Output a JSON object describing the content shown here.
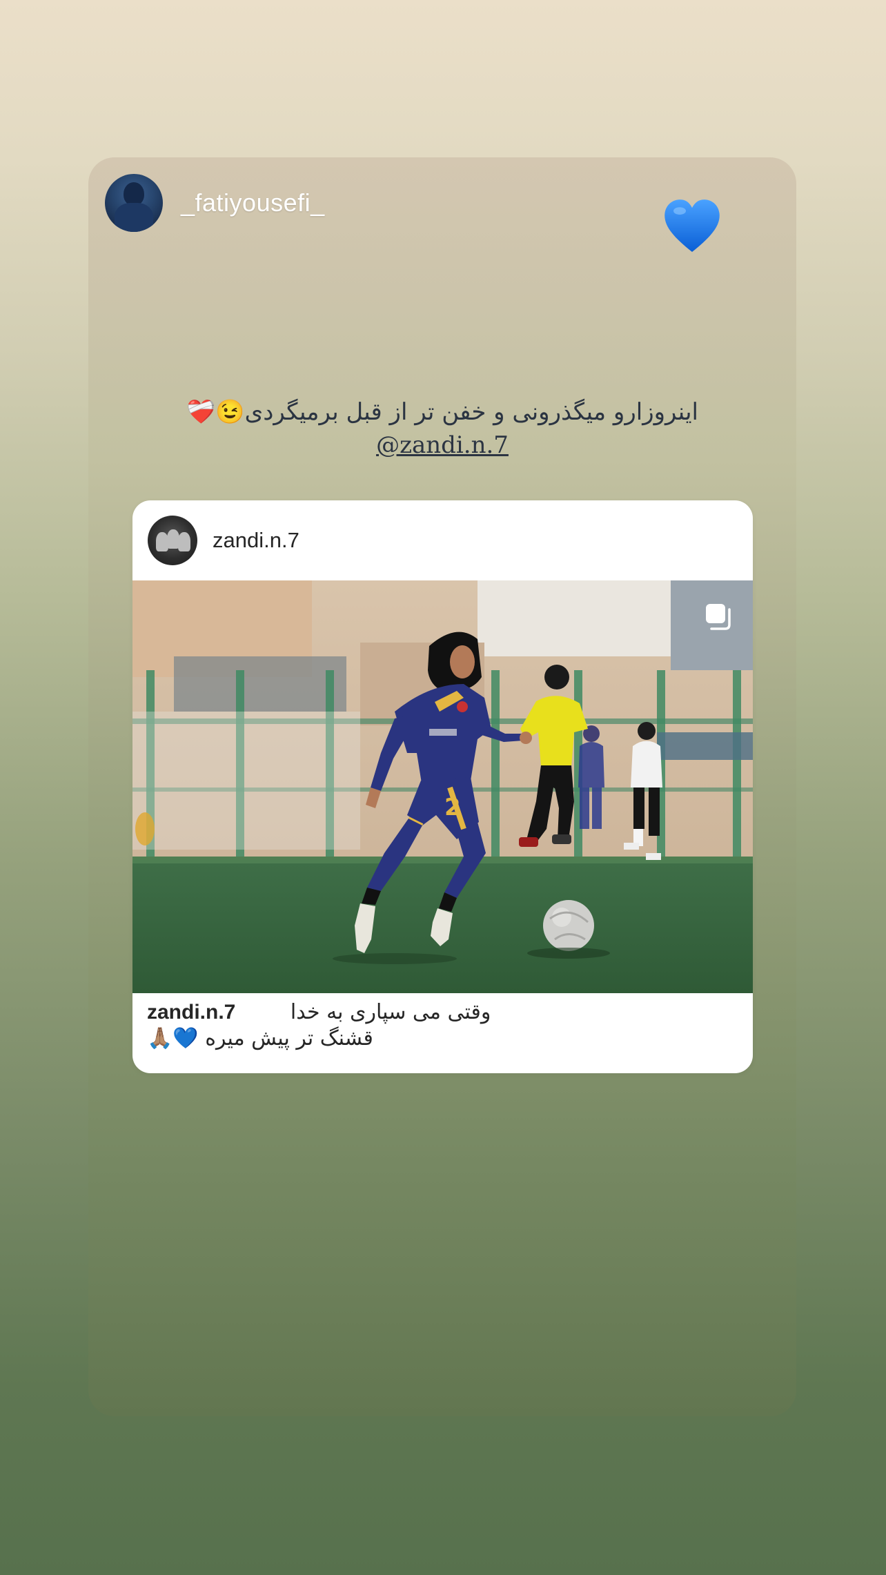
{
  "story": {
    "username": "_fatiyousefi_",
    "avatar_icon": "profile-avatar",
    "sticker_icon": "blue-heart-icon",
    "caption_line1": "اینروزارو میگذرونی و خفن تر از قبل برمیگردی😉❤️‍🩹",
    "mention": "@zandi.n.7"
  },
  "shared_post": {
    "username": "zandi.n.7",
    "avatar_icon": "profile-avatar",
    "carousel_icon": "carousel-icon",
    "caption_line1": "وقتی می سپاری به خدا",
    "caption_line2": "قشنگ تر پیش میره 💙🙏🏽"
  },
  "colors": {
    "caption_text": "#2b3442",
    "heart": "#1e7ff0",
    "post_bg": "#ffffff",
    "post_text": "#262626"
  }
}
